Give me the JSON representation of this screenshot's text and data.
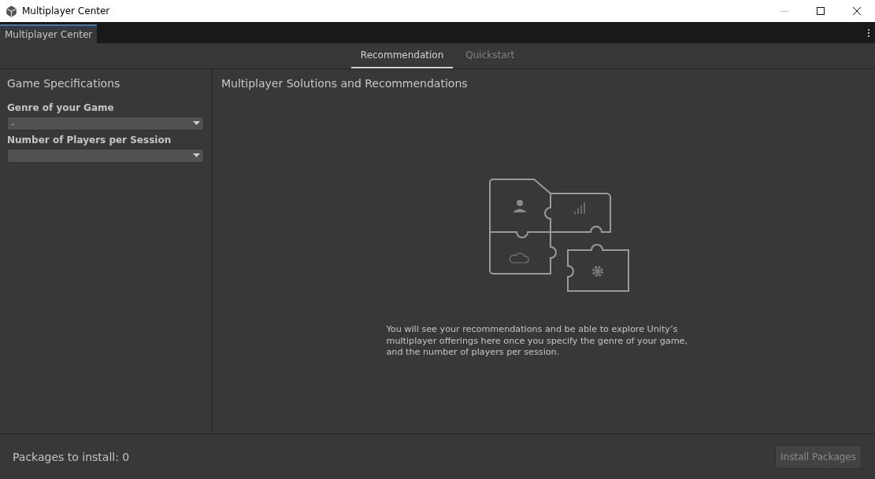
{
  "window": {
    "title": "Multiplayer Center"
  },
  "editor_tab": {
    "label": "Multiplayer Center",
    "selected": true
  },
  "tabs": [
    {
      "label": "Recommendation",
      "selected": true
    },
    {
      "label": "Quickstart",
      "selected": false
    }
  ],
  "sidebar": {
    "title": "Game Specifications",
    "fields": [
      {
        "label": "Genre of your Game",
        "value": "-"
      },
      {
        "label": "Number of Players per Session"
      }
    ]
  },
  "main": {
    "title": "Multiplayer Solutions and Recommendations",
    "message": "You will see your recommendations and be able to explore Unity’s multiplayer offerings here once you specify the genre of your game, and the number of players per session."
  },
  "footer": {
    "status": "Packages to install: 0",
    "button": {
      "label": "Install Packages",
      "disabled": true
    }
  }
}
